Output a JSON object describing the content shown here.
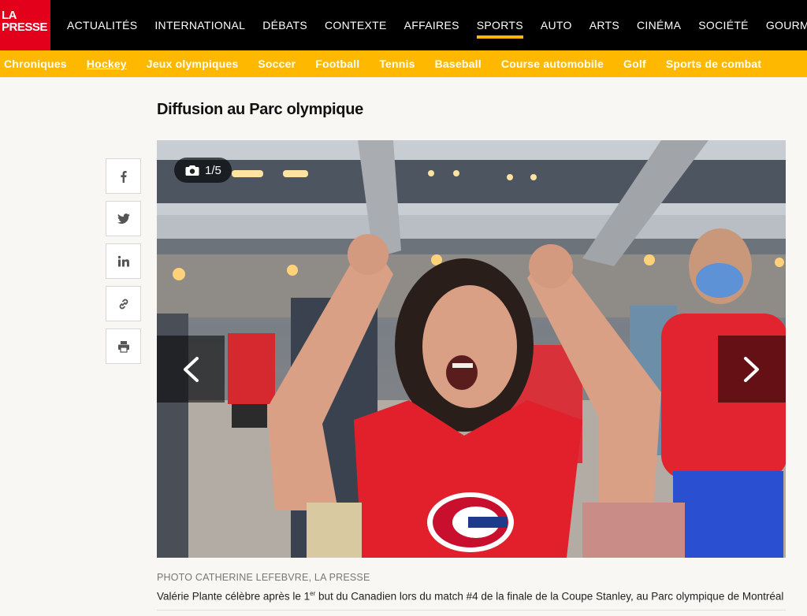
{
  "logo": {
    "line1": "LA",
    "line2": "PRESSE"
  },
  "nav": {
    "items": [
      {
        "label": "ACTUALITÉS",
        "key": "actualites"
      },
      {
        "label": "INTERNATIONAL",
        "key": "international"
      },
      {
        "label": "DÉBATS",
        "key": "debats"
      },
      {
        "label": "CONTEXTE",
        "key": "contexte"
      },
      {
        "label": "AFFAIRES",
        "key": "affaires"
      },
      {
        "label": "SPORTS",
        "key": "sports",
        "active": true
      },
      {
        "label": "AUTO",
        "key": "auto"
      },
      {
        "label": "ARTS",
        "key": "arts"
      },
      {
        "label": "CINÉMA",
        "key": "cinema"
      },
      {
        "label": "SOCIÉTÉ",
        "key": "societe"
      },
      {
        "label": "GOURMAND",
        "key": "gourmand"
      }
    ]
  },
  "subnav": {
    "items": [
      {
        "label": "Chroniques",
        "key": "chroniques"
      },
      {
        "label": "Hockey",
        "key": "hockey",
        "active": true
      },
      {
        "label": "Jeux olympiques",
        "key": "jeux-olympiques"
      },
      {
        "label": "Soccer",
        "key": "soccer"
      },
      {
        "label": "Football",
        "key": "football"
      },
      {
        "label": "Tennis",
        "key": "tennis"
      },
      {
        "label": "Baseball",
        "key": "baseball"
      },
      {
        "label": "Course automobile",
        "key": "course-automobile"
      },
      {
        "label": "Golf",
        "key": "golf"
      },
      {
        "label": "Sports de combat",
        "key": "sports-de-combat"
      }
    ]
  },
  "article": {
    "title": "Diffusion au Parc olympique"
  },
  "share": [
    "facebook-icon",
    "twitter-icon",
    "linkedin-icon",
    "link-icon",
    "print-icon"
  ],
  "gallery": {
    "counter": "1/5",
    "credit": "PHOTO CATHERINE LEFEBVRE, LA PRESSE",
    "caption_before": "Valérie Plante célèbre après le 1",
    "caption_sup": "er",
    "caption_after": " but du Canadien lors du match #4 de la finale de la Coupe Stanley, au Parc olympique de Montréal"
  },
  "colors": {
    "brand": "#e2001a",
    "accent": "#ffb800",
    "nav_bg": "#000000"
  }
}
